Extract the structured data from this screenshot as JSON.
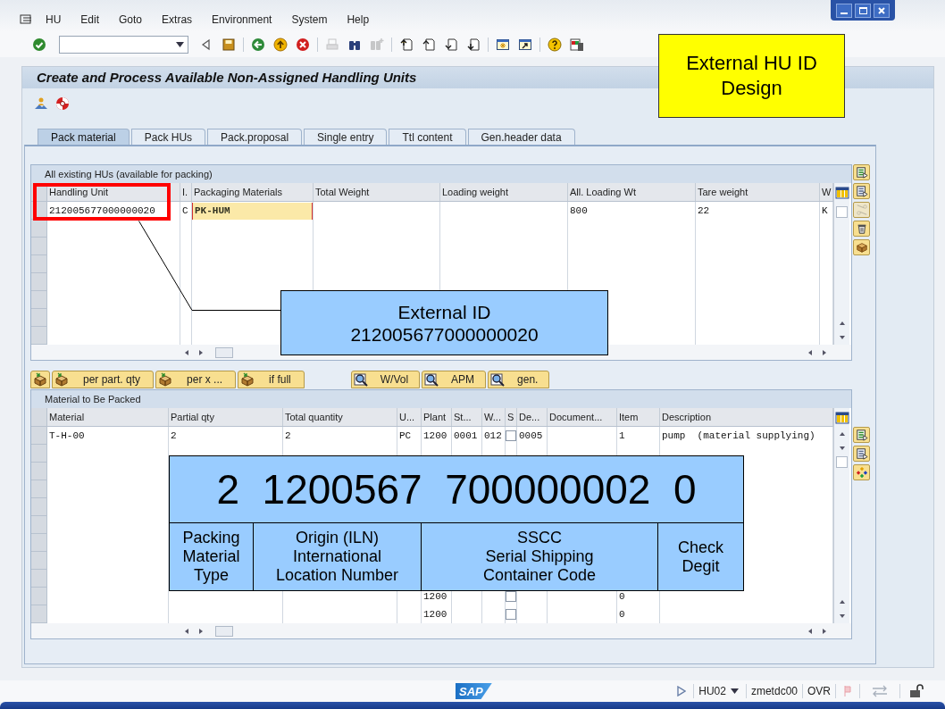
{
  "menu": [
    "HU",
    "Edit",
    "Goto",
    "Extras",
    "Environment",
    "System",
    "Help"
  ],
  "toolbar": [
    {
      "kind": "enter",
      "disabled": false
    },
    {
      "kind": "field"
    },
    {
      "kind": "collapse",
      "disabled": false
    },
    {
      "kind": "save",
      "disabled": false
    },
    {
      "kind": "sep"
    },
    {
      "kind": "back",
      "disabled": false
    },
    {
      "kind": "exit",
      "disabled": false
    },
    {
      "kind": "cancel",
      "disabled": false
    },
    {
      "kind": "sep"
    },
    {
      "kind": "print",
      "disabled": true
    },
    {
      "kind": "find",
      "disabled": false
    },
    {
      "kind": "find_next",
      "disabled": true
    },
    {
      "kind": "sep"
    },
    {
      "kind": "first",
      "disabled": false
    },
    {
      "kind": "prev",
      "disabled": false
    },
    {
      "kind": "next",
      "disabled": false
    },
    {
      "kind": "last",
      "disabled": false
    },
    {
      "kind": "sep"
    },
    {
      "kind": "session",
      "disabled": false
    },
    {
      "kind": "shortcut",
      "disabled": false
    },
    {
      "kind": "sep"
    },
    {
      "kind": "help",
      "disabled": false
    },
    {
      "kind": "layout",
      "disabled": false
    }
  ],
  "screen_title": "Create and Process Available Non-Assigned Handling Units",
  "app_toolbar": [
    {
      "kind": "person"
    },
    {
      "kind": "lifebuoy"
    }
  ],
  "tabs": [
    {
      "label": "Pack material",
      "selected": true
    },
    {
      "label": "Pack HUs",
      "selected": false
    },
    {
      "label": "Pack.proposal",
      "selected": false
    },
    {
      "label": "Single entry",
      "selected": false
    },
    {
      "label": "Ttl content",
      "selected": false
    },
    {
      "label": "Gen.header data",
      "selected": false
    }
  ],
  "hu_table": {
    "title": "All existing HUs (available for packing)",
    "columns": [
      {
        "label": "Handling Unit",
        "kind": "text"
      },
      {
        "label": "I.",
        "kind": "text"
      },
      {
        "label": "Packaging Materials",
        "kind": "input"
      },
      {
        "label": "Total Weight",
        "kind": "text"
      },
      {
        "label": "Loading weight",
        "kind": "text"
      },
      {
        "label": "All. Loading Wt",
        "kind": "text"
      },
      {
        "label": "Tare weight",
        "kind": "text"
      },
      {
        "label": "W",
        "kind": "text"
      }
    ],
    "rows": [
      {
        "cells": [
          {
            "text": "212005677000000020"
          },
          {
            "text": "C"
          },
          {
            "text": "PK-HUM"
          },
          {},
          {},
          {
            "text": "800"
          },
          {
            "text": "22"
          },
          {
            "text": "K"
          }
        ]
      }
    ],
    "side_buttons": [
      {
        "kind": "detail",
        "disabled": false
      },
      {
        "kind": "detail_alt",
        "disabled": false
      },
      {
        "kind": "scissors",
        "disabled": true
      },
      {
        "kind": "trash",
        "disabled": false
      },
      {
        "kind": "unpack",
        "disabled": false
      }
    ]
  },
  "pack_buttons": [
    {
      "kind": "pack"
    },
    {
      "kind": "pack",
      "label": "per part. qty"
    },
    {
      "kind": "pack",
      "label": "per x ..."
    },
    {
      "kind": "pack",
      "label": "if full"
    }
  ],
  "find_buttons": [
    {
      "kind": "find",
      "label": "W/Vol"
    },
    {
      "kind": "find",
      "label": "APM"
    },
    {
      "kind": "find",
      "label": "gen."
    }
  ],
  "material_table": {
    "title": "Material to Be Packed",
    "columns": [
      {
        "label": "Material",
        "kind": "text"
      },
      {
        "label": "Partial qty",
        "kind": "text"
      },
      {
        "label": "Total quantity",
        "kind": "text"
      },
      {
        "label": "U...",
        "kind": "text"
      },
      {
        "label": "Plant",
        "kind": "text"
      },
      {
        "label": "St...",
        "kind": "text"
      },
      {
        "label": "W...",
        "kind": "text"
      },
      {
        "label": "S",
        "kind": "checkbox"
      },
      {
        "label": "De...",
        "kind": "text"
      },
      {
        "label": "Document...",
        "kind": "text"
      },
      {
        "label": "Item",
        "kind": "text"
      },
      {
        "label": "Description",
        "kind": "text"
      }
    ],
    "rows": [
      {
        "cells": [
          {
            "text": "T-H-00"
          },
          {
            "text": "2"
          },
          {
            "text": "2"
          },
          {
            "text": "PC"
          },
          {
            "text": "1200"
          },
          {
            "text": "0001"
          },
          {
            "text": "012"
          },
          {
            "checked": false
          },
          {
            "text": "0005"
          },
          {},
          {
            "text": "1"
          },
          {
            "text": "pump  (material supplying)"
          }
        ]
      }
    ],
    "last_rows": [
      {
        "cells": [
          {},
          {},
          {},
          {},
          {
            "text": "1200"
          },
          {},
          {},
          {
            "checked": false
          },
          {},
          {},
          {
            "text": "0"
          },
          {}
        ]
      },
      {
        "cells": [
          {},
          {},
          {},
          {},
          {
            "text": "1200"
          },
          {},
          {},
          {
            "checked": false
          },
          {},
          {},
          {
            "text": "0"
          },
          {}
        ]
      }
    ],
    "side_buttons": [
      {
        "kind": "detail",
        "disabled": false
      },
      {
        "kind": "detail_alt",
        "disabled": false
      },
      {
        "kind": "hierarchy",
        "disabled": false
      }
    ]
  },
  "status_bar": {
    "logo": "SAP",
    "transaction": "HU02",
    "server": "zmetdc00",
    "mode": "OVR"
  },
  "annotations": {
    "design_note": "External HU ID Design",
    "external_id": {
      "title": "External ID",
      "value": "212005677000000020"
    },
    "structure": {
      "number": "2  1200567  700000002  0",
      "parts": [
        {
          "lines": [
            "Packing",
            "Material",
            "Type"
          ]
        },
        {
          "lines": [
            "Origin (ILN)",
            "International",
            "Location Number"
          ]
        },
        {
          "lines": [
            "SSCC",
            "Serial Shipping",
            "Container Code"
          ]
        },
        {
          "lines": [
            "Check",
            "Degit"
          ]
        }
      ]
    }
  }
}
